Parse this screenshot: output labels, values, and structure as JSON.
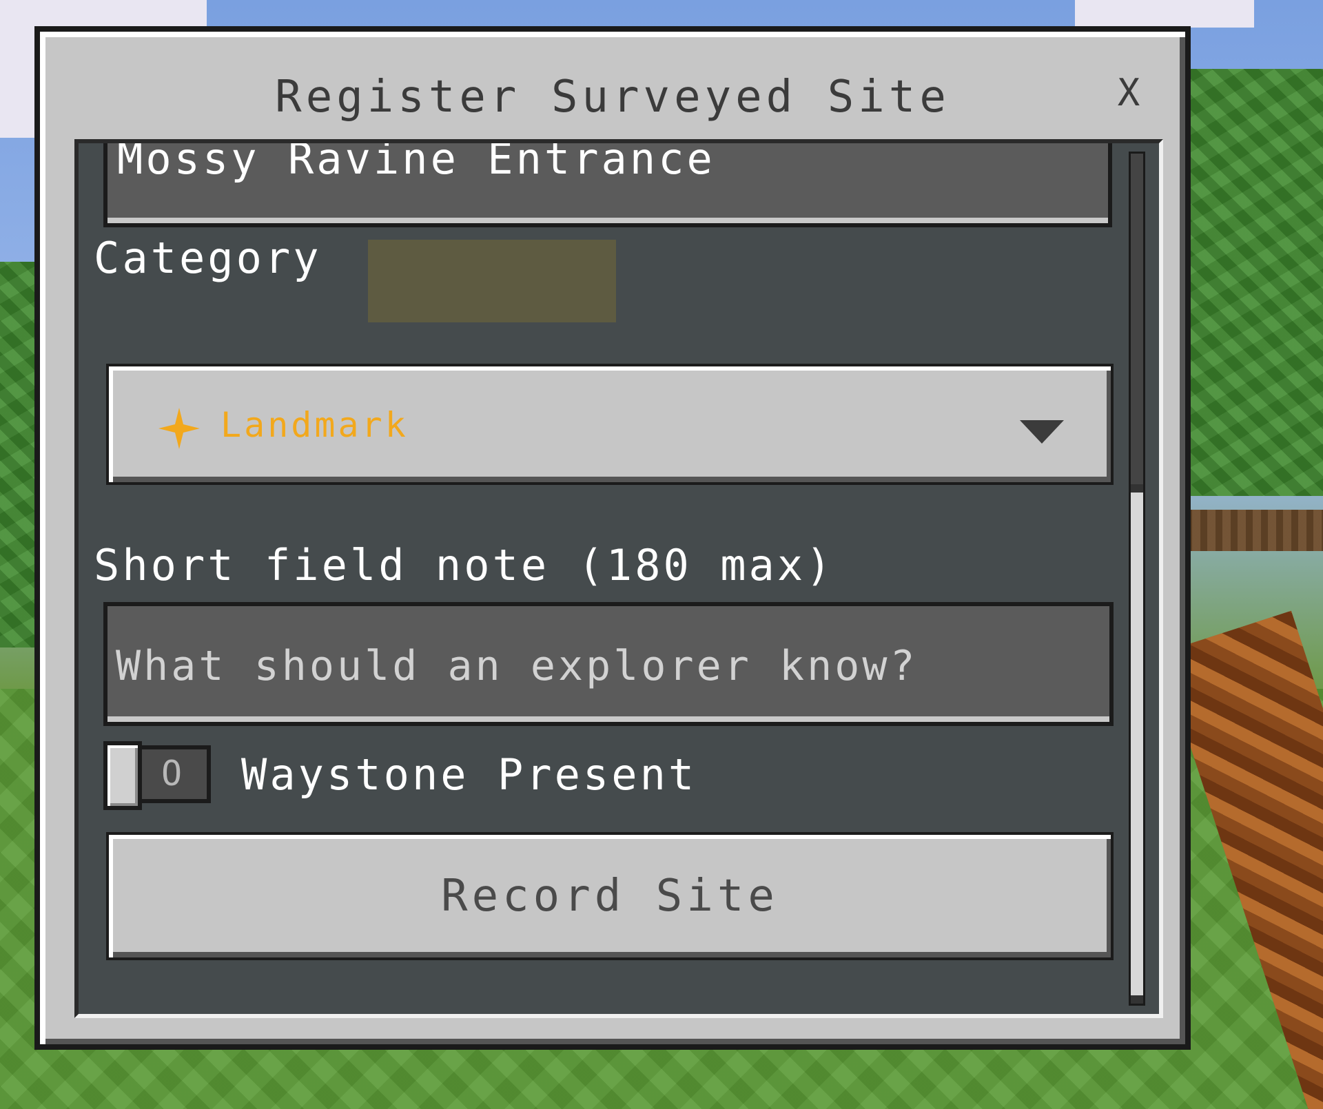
{
  "dialog": {
    "title": "Register Surveyed Site",
    "close_symbol": "X"
  },
  "form": {
    "site_name_value": "Mossy Ravine Entrance",
    "category_label": "Category",
    "category_selected": "Landmark",
    "category_icon": "star-icon",
    "category_color": "#f2a81c",
    "note_label": "Short field note (180 max)",
    "note_placeholder": "What should an explorer know?",
    "waystone_toggle_state": "O",
    "waystone_label": "Waystone Present",
    "waystone_on": false,
    "record_button_label": "Record Site"
  }
}
